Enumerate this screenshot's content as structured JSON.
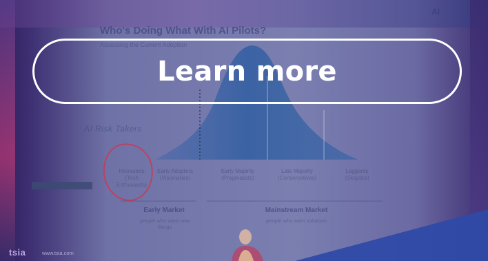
{
  "slide": {
    "title": "Who's Doing What With AI Pilots?",
    "subtitle": "Assessing the Current Adoption",
    "corner_logo": "AI",
    "axis_label": "AI Risk Takers",
    "categories": [
      {
        "name": "Innovators",
        "sub": "(Tech Enthusiasts)"
      },
      {
        "name": "Early Adopters",
        "sub": "(Visionaries)"
      },
      {
        "name": "Early Majority",
        "sub": "(Pragmatists)"
      },
      {
        "name": "Late Majority",
        "sub": "(Conservatives)"
      },
      {
        "name": "Laggards",
        "sub": "(Skeptics)"
      }
    ],
    "markets": [
      {
        "name": "Early Market",
        "sub": "people who want new things"
      },
      {
        "name": "Mainstream Market",
        "sub": "people who want solutions"
      }
    ],
    "footer": {
      "logo": "tsia",
      "url": "www.tsia.com"
    }
  },
  "cta": {
    "label": "Learn more"
  }
}
